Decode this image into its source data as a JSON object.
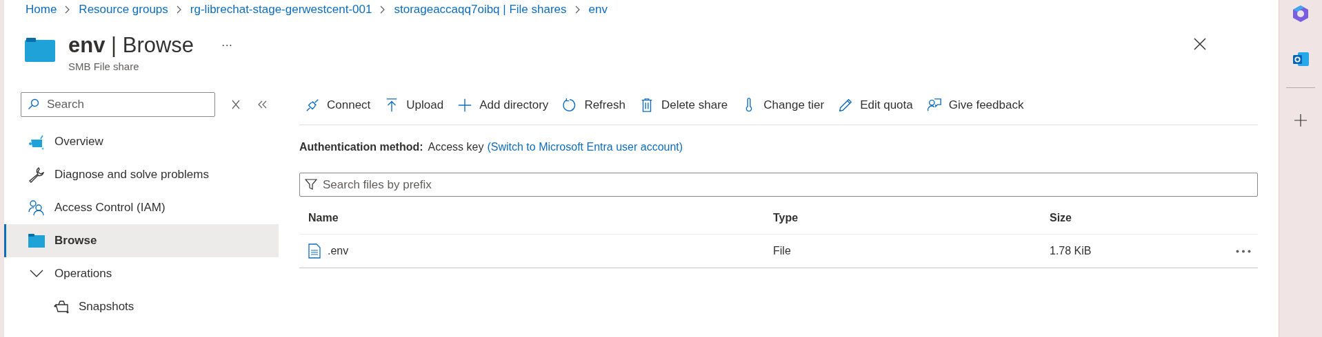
{
  "breadcrumb": [
    "Home",
    "Resource groups",
    "rg-librechat-stage-gerwestcent-001",
    "storageaccaqq7oibq | File shares",
    "env"
  ],
  "header": {
    "title": "**env** | Browse",
    "subtitle": "SMB File share",
    "more": "···"
  },
  "sidebar": {
    "search": {
      "placeholder": "Search"
    },
    "items": [
      {
        "label": "Overview",
        "selected": false
      },
      {
        "label": "Diagnose and solve problems",
        "selected": false
      },
      {
        "label": "Access Control (IAM)",
        "selected": false
      },
      {
        "label": "Browse",
        "selected": true
      },
      {
        "label": "Operations",
        "selected": false,
        "expanded": true,
        "children": [
          {
            "label": "Snapshots",
            "selected": false
          }
        ]
      }
    ]
  },
  "toolbar": [
    "Connect",
    "Upload",
    "Add directory",
    "Refresh",
    "Delete share",
    "Change tier",
    "Edit quota",
    "Give feedback"
  ],
  "auth": {
    "label": "Authentication method:",
    "value": "Access key",
    "link": "(Switch to Microsoft Entra user account)"
  },
  "filter": {
    "placeholder": "Search files by prefix"
  },
  "table": {
    "columns": [
      "Name",
      "Type",
      "Size"
    ],
    "rows": [
      {
        "name": ".env",
        "type": "File",
        "size": "1.78 KiB"
      }
    ]
  }
}
